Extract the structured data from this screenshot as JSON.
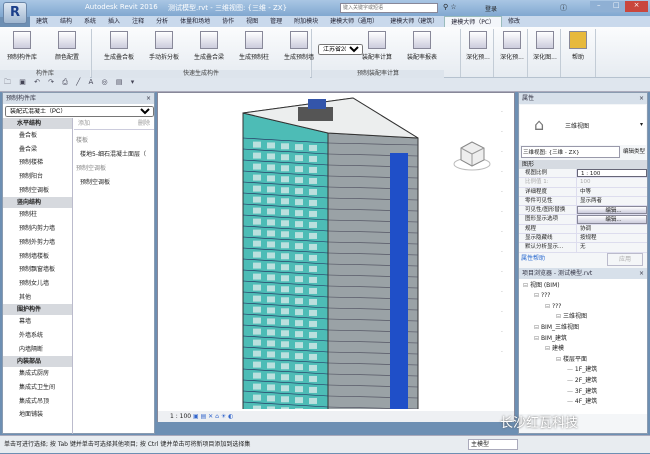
{
  "titlebar": {
    "app": "Autodesk Revit 2016",
    "doc": "测试模型.rvt - 三维视图: {三维 - ZX}",
    "search_placeholder": "键入关键字或短语",
    "user": "登录",
    "app_button": "R"
  },
  "tabs": [
    "建筑",
    "结构",
    "系统",
    "插入",
    "注释",
    "分析",
    "体量和场地",
    "协作",
    "视图",
    "管理",
    "附加模块",
    "建模大师（通用）",
    "建模大师（建筑）",
    "建模大师（PC）",
    "修改"
  ],
  "active_tab": 13,
  "ribbon": {
    "buttons": [
      "预制构件库",
      "颜色配置",
      "生成叠合板",
      "手动拆分板",
      "生成叠合梁",
      "生成预制柱",
      "生成预制墙",
      "装配率计算",
      "装配率报表",
      "深化预...",
      "深化预...",
      "深化图...",
      "帮助"
    ],
    "region_select": "江苏省2017",
    "panels": [
      "构件库",
      "快速生成构件",
      "预制装配率计算"
    ]
  },
  "library": {
    "title": "预制构件库",
    "type_select": "装配式混凝土（PC）",
    "add": "添加",
    "delete": "删除",
    "groups": [
      {
        "name": "水平结构",
        "items": [
          "叠合板",
          "叠合梁",
          "预制楼梯",
          "预制阳台",
          "预制空调板"
        ]
      },
      {
        "name": "竖向结构",
        "items": [
          "预制柱",
          "预制内剪力墙",
          "预制外剪力墙",
          "预制墙楼板",
          "预制飘窗墙板",
          "预制女儿墙",
          "其他"
        ]
      },
      {
        "name": "围护构件",
        "items": [
          "幕墙",
          "外墙系统",
          "内墙隔断"
        ]
      },
      {
        "name": "内装部品",
        "items": [
          "集成式厨房",
          "集成式卫生间",
          "集成式吊顶",
          "地面铺装"
        ]
      }
    ],
    "content": [
      {
        "header": "楼板",
        "items": [
          "楼地5-细石混凝土面层（"
        ]
      },
      {
        "header": "预制空调板",
        "items": [
          "预制空调板"
        ]
      }
    ]
  },
  "view": {
    "scale": "1 : 100"
  },
  "properties": {
    "title": "属性",
    "type_name": "三维视图",
    "view_select": "三维视图: {三维 - ZX}",
    "edit_type": "编辑类型",
    "section": "图形",
    "rows": [
      [
        "视图比例",
        "1 : 100"
      ],
      [
        "比例值 1:",
        "100"
      ],
      [
        "详细程度",
        "中等"
      ],
      [
        "零件可见性",
        "显示两者"
      ],
      [
        "可见性/图形替换",
        "编辑..."
      ],
      [
        "图形显示选项",
        "编辑..."
      ],
      [
        "规程",
        "协调"
      ],
      [
        "显示隐藏线",
        "按规程"
      ],
      [
        "默认分析显示...",
        "无"
      ]
    ],
    "help": "属性帮助",
    "apply": "应用"
  },
  "browser": {
    "title": "项目浏览器 - 测试模型.rvt",
    "tree": [
      [
        "视图 (BIM)",
        0
      ],
      [
        "???",
        1
      ],
      [
        "???",
        2
      ],
      [
        "三维视图",
        3
      ],
      [
        "BIM_三维视图",
        1
      ],
      [
        "BIM_建筑",
        1
      ],
      [
        "建模",
        2
      ],
      [
        "楼层平面",
        3
      ],
      [
        "1F_建筑",
        4
      ],
      [
        "2F_建筑",
        4
      ],
      [
        "3F_建筑",
        4
      ],
      [
        "4F_建筑",
        4
      ]
    ]
  },
  "watermark": "长沙红瓦科技",
  "status": {
    "text": "单击可进行选择; 按 Tab 键并单击可选择其他项目; 按 Ctrl 键并单击可将新项目添加到选择集",
    "model": "主模型"
  },
  "colors": {
    "accent": "#1c3f8a",
    "building_glass": "#3fb4b0",
    "building_blue": "#1f4fc8"
  }
}
